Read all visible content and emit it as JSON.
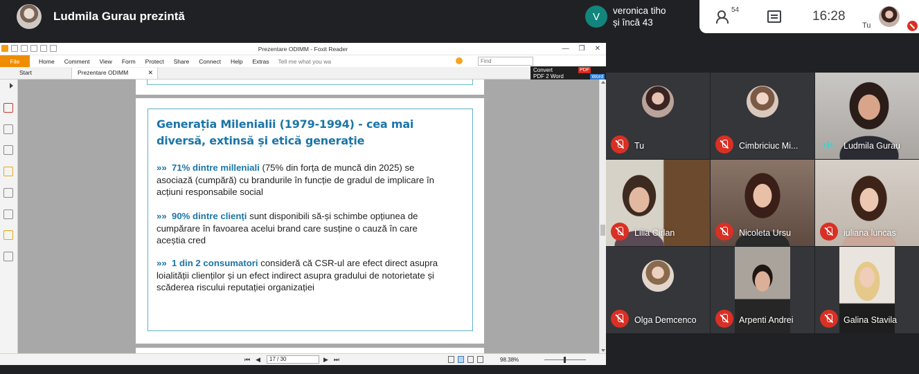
{
  "presenter": {
    "name": "Ludmila Gurau prezintă"
  },
  "viewers": {
    "initial": "V",
    "line1": "veronica tiho",
    "line2": "și încă 43"
  },
  "topbar": {
    "participants_count": "54",
    "time": "16:28",
    "self_label": "Tu"
  },
  "foxit": {
    "title": "Prezentare ODIMM - Foxit Reader",
    "menu": {
      "file": "File",
      "items": [
        "Home",
        "Comment",
        "View",
        "Form",
        "Protect",
        "Share",
        "Connect",
        "Help",
        "Extras"
      ],
      "tell": "Tell me what you wa"
    },
    "find_placeholder": "Find",
    "tabs": [
      "Start",
      "Prezentare ODIMM"
    ],
    "convert": {
      "line1": "Convert",
      "line2": "PDF 2 Word",
      "pdf": "PDF",
      "word": "Word"
    },
    "status": {
      "page": "17 / 30",
      "zoom": "98.38%"
    }
  },
  "slide": {
    "title": "Generația Milenialii (1979-1994) - cea mai diversă, extinsă și etică generație",
    "bullets": [
      {
        "marker": "»»",
        "highlight": "71% dintre milleniali",
        "text": " (75% din forța de muncă din 2025) se asociază (cumpără) cu brandurile în funcție de gradul de implicare în acțiuni responsabile social"
      },
      {
        "marker": "»»",
        "highlight": "90% dintre clienți",
        "text": " sunt disponibili să-și schimbe opțiunea de cumpărare în favoarea acelui brand care susține o cauză în care aceștia cred"
      },
      {
        "marker": "»»",
        "highlight": "1 din 2 consumatori",
        "text": " consideră că CSR-ul are efect direct asupra loialității clienților și un efect indirect asupra gradului de notorietate și scăderea riscului reputației organizației"
      }
    ]
  },
  "participants": [
    {
      "name": "Tu",
      "muted": true
    },
    {
      "name": "Cimbriciuc Mi...",
      "muted": true
    },
    {
      "name": "Ludmila Gurau",
      "muted": false,
      "speaking": true
    },
    {
      "name": "Lilia Cirlan",
      "muted": true
    },
    {
      "name": "Nicoleta Ursu",
      "muted": true
    },
    {
      "name": "iuliana luncas",
      "muted": true
    },
    {
      "name": "Olga Demcenco",
      "muted": true
    },
    {
      "name": "Arpenti Andrei",
      "muted": true
    },
    {
      "name": "Galina Stavila",
      "muted": true
    }
  ],
  "colors": {
    "accent_blue": "#1a75a8",
    "mute_red": "#d93025",
    "foxit_orange": "#f08c00",
    "meet_bg": "#202124",
    "tile_bg": "#3c4043"
  }
}
